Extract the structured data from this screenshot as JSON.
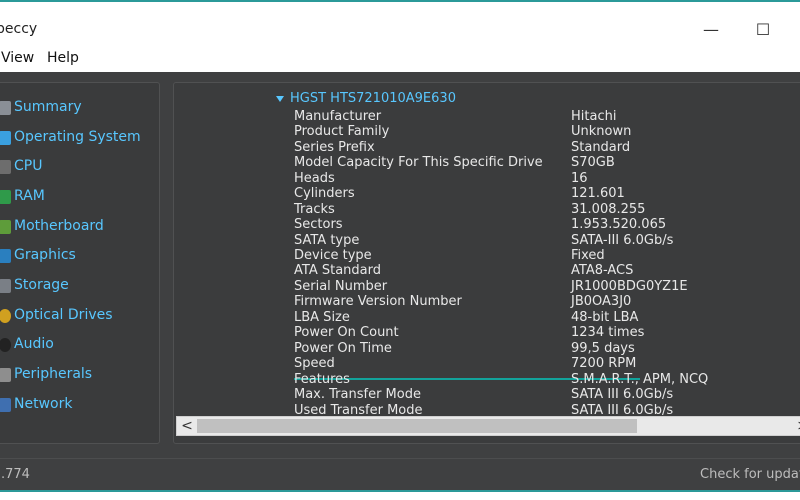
{
  "window": {
    "title": "peccy",
    "minimize_symbol": "—",
    "maximize_symbol": "☐"
  },
  "menu": [
    {
      "label": "View"
    },
    {
      "label": "Help"
    }
  ],
  "sidebar": {
    "items": [
      {
        "label": "Summary",
        "icon": "summary-icon",
        "color": "#8a8f96"
      },
      {
        "label": "Operating System",
        "icon": "windows-icon",
        "color": "#3aa0e0"
      },
      {
        "label": "CPU",
        "icon": "cpu-icon",
        "color": "#6d6d6d"
      },
      {
        "label": "RAM",
        "icon": "ram-icon",
        "color": "#2f9a4a"
      },
      {
        "label": "Motherboard",
        "icon": "motherboard-icon",
        "color": "#5e9c3a"
      },
      {
        "label": "Graphics",
        "icon": "graphics-icon",
        "color": "#2a7fbf"
      },
      {
        "label": "Storage",
        "icon": "storage-icon",
        "color": "#7a7f86"
      },
      {
        "label": "Optical Drives",
        "icon": "optical-drive-icon",
        "color": "#d0a020"
      },
      {
        "label": "Audio",
        "icon": "audio-icon",
        "color": "#333333"
      },
      {
        "label": "Peripherals",
        "icon": "peripherals-icon",
        "color": "#8e8e8e"
      },
      {
        "label": "Network",
        "icon": "network-icon",
        "color": "#3f6fb0"
      }
    ]
  },
  "drive": {
    "name": "HGST HTS721010A9E630",
    "properties": [
      {
        "key": "Manufacturer",
        "value": "Hitachi"
      },
      {
        "key": "Product Family",
        "value": "Unknown"
      },
      {
        "key": "Series Prefix",
        "value": "Standard"
      },
      {
        "key": "Model Capacity For This Specific Drive",
        "value": "S70GB"
      },
      {
        "key": "Heads",
        "value": "16"
      },
      {
        "key": "Cylinders",
        "value": "121.601"
      },
      {
        "key": "Tracks",
        "value": "31.008.255"
      },
      {
        "key": "Sectors",
        "value": "1.953.520.065"
      },
      {
        "key": "SATA type",
        "value": "SATA-III 6.0Gb/s"
      },
      {
        "key": "Device type",
        "value": "Fixed"
      },
      {
        "key": "ATA Standard",
        "value": "ATA8-ACS"
      },
      {
        "key": "Serial Number",
        "value": "JR1000BDG0YZ1E"
      },
      {
        "key": "Firmware Version Number",
        "value": "JB0OA3J0"
      },
      {
        "key": "LBA Size",
        "value": "48-bit LBA"
      },
      {
        "key": "Power On Count",
        "value": "1234 times"
      },
      {
        "key": "Power On Time",
        "value": "99,5 days"
      },
      {
        "key": "Speed",
        "value": "7200 RPM"
      },
      {
        "key": "Features",
        "value": "S.M.A.R.T., APM, NCQ"
      },
      {
        "key": "Max. Transfer Mode",
        "value": "SATA III 6.0Gb/s"
      },
      {
        "key": "Used Transfer Mode",
        "value": "SATA III 6.0Gb/s"
      }
    ]
  },
  "scrollbar": {
    "left_arrow": "<",
    "right_arrow": ">"
  },
  "status": {
    "version": ".774",
    "check_updates": "Check for updat"
  }
}
